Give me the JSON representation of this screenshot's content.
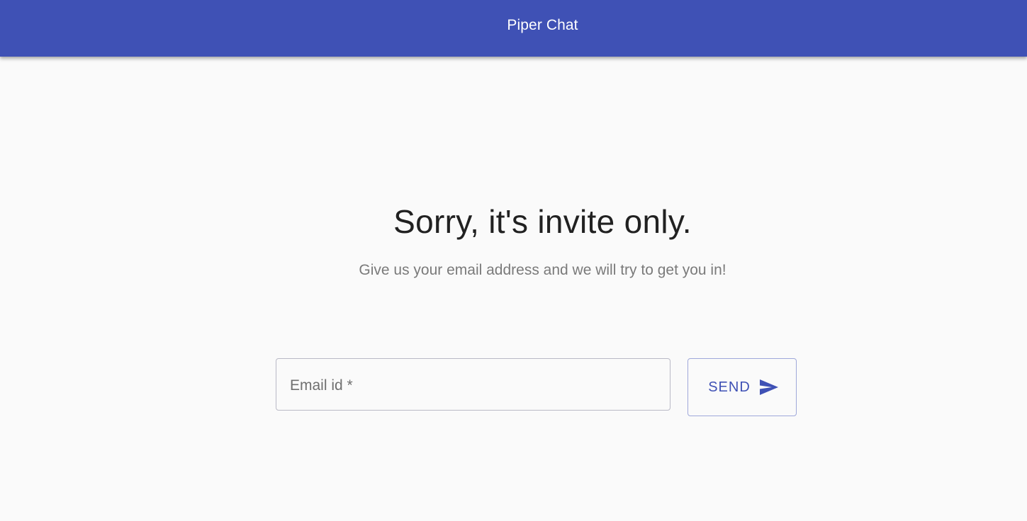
{
  "app_bar": {
    "title": "Piper Chat",
    "color": "#3f51b5"
  },
  "main": {
    "headline": "Sorry, it's invite only.",
    "subline": "Give us your email address and we will try to get you in!"
  },
  "form": {
    "email_label": "Email id *",
    "email_value": "",
    "send_label": "SEND",
    "send_icon": "send-icon"
  }
}
